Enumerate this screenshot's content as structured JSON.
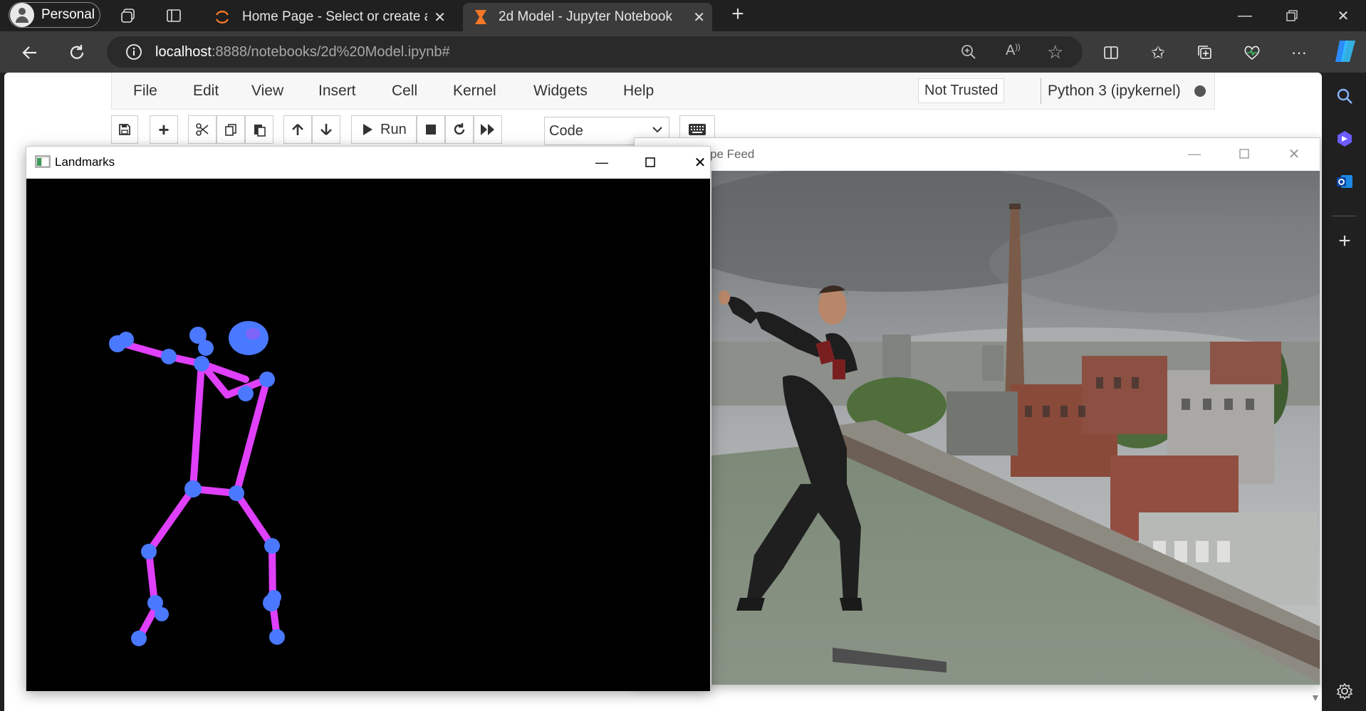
{
  "browser": {
    "profile_label": "Personal",
    "tabs": [
      {
        "title": "Home Page - Select or create a n",
        "icon": "jupyter-spinner-icon"
      },
      {
        "title": "2d Model - Jupyter Notebook",
        "icon": "hourglass-icon"
      }
    ],
    "url_host": "localhost",
    "url_path": ":8888/notebooks/2d%20Model.ipynb#"
  },
  "jupyter": {
    "menu": [
      "File",
      "Edit",
      "View",
      "Insert",
      "Cell",
      "Kernel",
      "Widgets",
      "Help"
    ],
    "trust_status": "Not Trusted",
    "kernel_name": "Python 3 (ipykernel)",
    "run_label": "Run",
    "cell_type": "Code"
  },
  "windows": {
    "landmarks_title": "Landmarks",
    "feed_title": "pe Feed"
  },
  "colors": {
    "skeleton_line": "#e040fb",
    "joint": "#4a78ff",
    "accent": "#ff6d00"
  }
}
